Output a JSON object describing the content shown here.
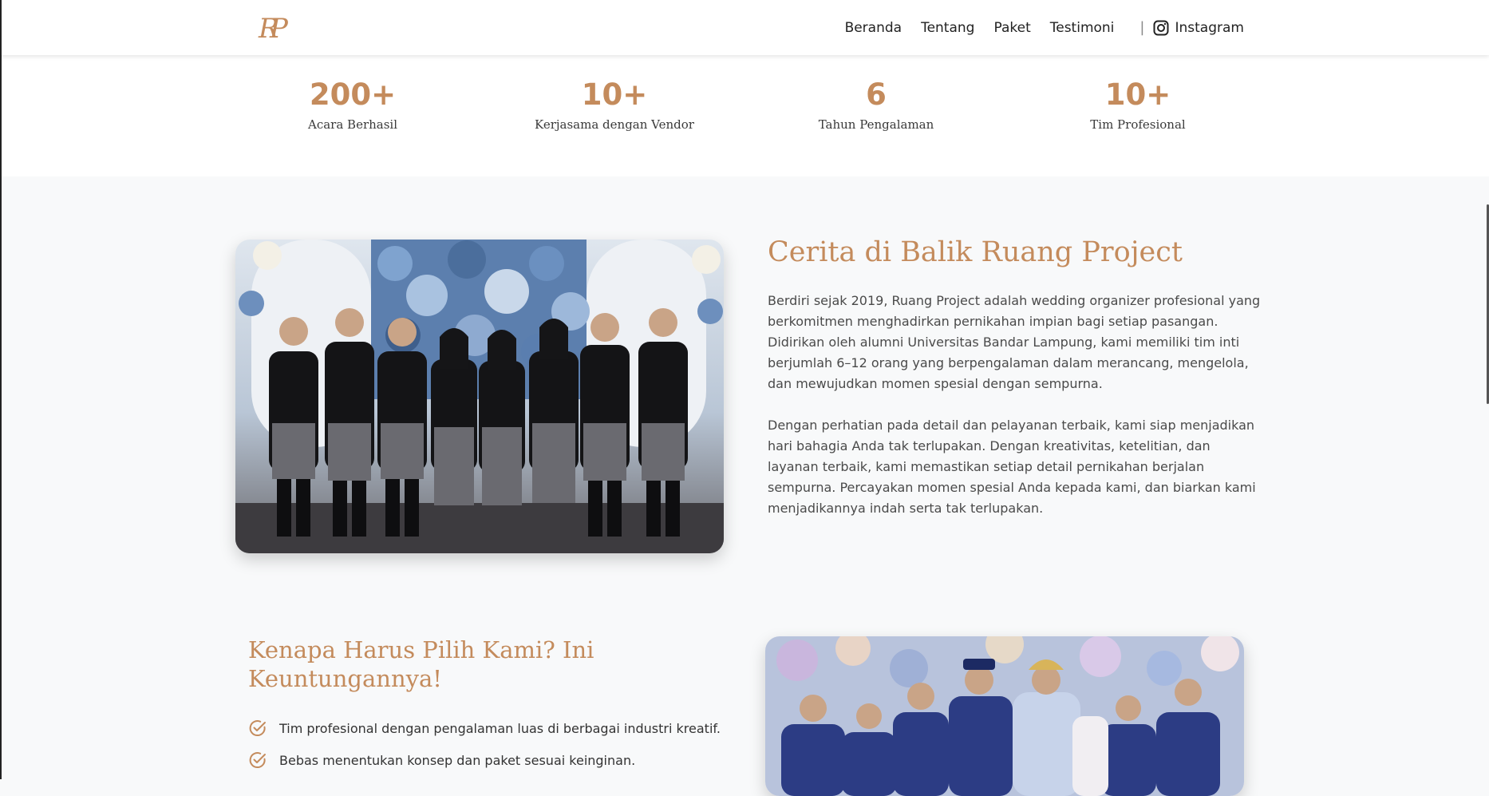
{
  "header": {
    "logo_text": "RP",
    "nav": [
      "Beranda",
      "Tentang",
      "Paket",
      "Testimoni"
    ],
    "separator": "|",
    "instagram_label": "Instagram"
  },
  "stats": [
    {
      "value": "200+",
      "label": "Acara Berhasil"
    },
    {
      "value": "10+",
      "label": "Kerjasama dengan Vendor"
    },
    {
      "value": "6",
      "label": "Tahun Pengalaman"
    },
    {
      "value": "10+",
      "label": "Tim Profesional"
    }
  ],
  "about": {
    "title": "Cerita di Balik Ruang Project",
    "paragraph1": "Berdiri sejak 2019, Ruang Project adalah wedding organizer profesional yang berkomitmen menghadirkan pernikahan impian bagi setiap pasangan. Didirikan oleh alumni Universitas Bandar Lampung, kami memiliki tim inti berjumlah 6–12 orang yang berpengalaman dalam merancang, mengelola, dan mewujudkan momen spesial dengan sempurna.",
    "paragraph2": "Dengan perhatian pada detail dan pelayanan terbaik, kami siap menjadikan hari bahagia Anda tak terlupakan. Dengan kreativitas, ketelitian, dan layanan terbaik, kami memastikan setiap detail pernikahan berjalan sempurna. Percayakan momen spesial Anda kepada kami, dan biarkan kami menjadikannya indah serta tak terlupakan."
  },
  "why": {
    "title": "Kenapa Harus Pilih Kami? Ini Keuntungannya!",
    "benefits": [
      "Tim profesional dengan pengalaman luas di berbagai industri kreatif.",
      "Bebas menentukan konsep dan paket sesuai keinginan."
    ]
  },
  "colors": {
    "accent": "#c48b5c",
    "text": "#4a4a4a",
    "background": "#f8f9fa"
  },
  "icons": [
    "check-circle-icon",
    "instagram-icon"
  ]
}
